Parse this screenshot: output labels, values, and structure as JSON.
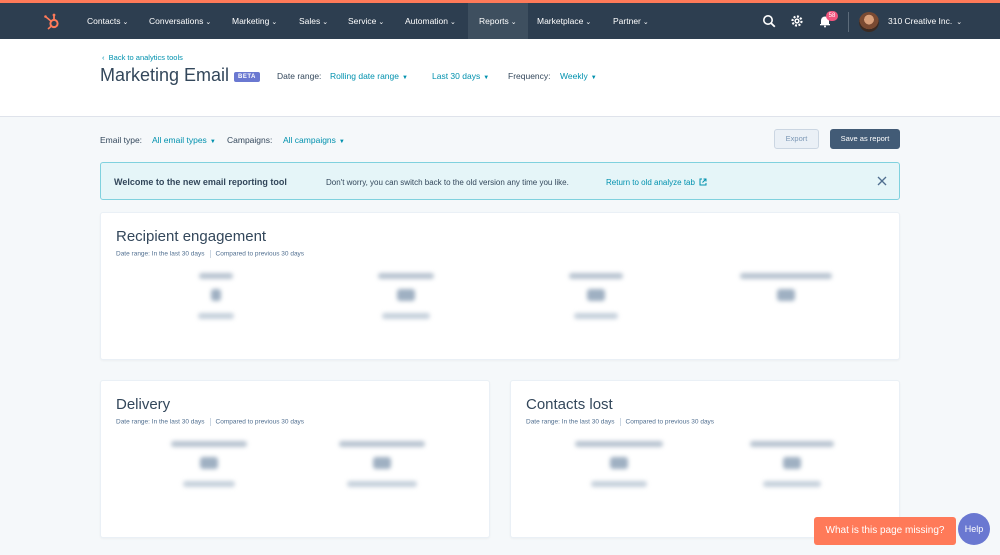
{
  "nav": {
    "items": [
      {
        "label": "Contacts"
      },
      {
        "label": "Conversations"
      },
      {
        "label": "Marketing"
      },
      {
        "label": "Sales"
      },
      {
        "label": "Service"
      },
      {
        "label": "Automation"
      },
      {
        "label": "Reports"
      },
      {
        "label": "Marketplace"
      },
      {
        "label": "Partner"
      }
    ],
    "active": "Reports",
    "notification_count": "58",
    "account": "310 Creative Inc."
  },
  "header": {
    "back_link": "Back to analytics tools",
    "title": "Marketing Email",
    "badge": "BETA",
    "date_range_label": "Date range:",
    "date_range_type": "Rolling date range",
    "date_range_value": "Last 30 days",
    "frequency_label": "Frequency:",
    "frequency_value": "Weekly"
  },
  "toolbar": {
    "email_type_label": "Email type:",
    "email_type_value": "All email types",
    "campaigns_label": "Campaigns:",
    "campaigns_value": "All campaigns",
    "export_label": "Export",
    "save_label": "Save as report"
  },
  "banner": {
    "title": "Welcome to the new email reporting tool",
    "text": "Don't worry, you can switch back to the old version any time you like.",
    "link": "Return to old analyze tab"
  },
  "cards": {
    "engagement": {
      "title": "Recipient engagement",
      "date_range": "Date range: In the last 30 days",
      "compared": "Compared to previous 30 days"
    },
    "delivery": {
      "title": "Delivery",
      "date_range": "Date range: In the last 30 days",
      "compared": "Compared to previous 30 days"
    },
    "contacts_lost": {
      "title": "Contacts lost",
      "date_range": "Date range: In the last 30 days",
      "compared": "Compared to previous 30 days"
    }
  },
  "floating": {
    "feedback": "What is this page missing?",
    "help": "Help"
  },
  "colors": {
    "nav_bg": "#2d3e50",
    "accent_orange": "#ff7a59",
    "link_teal": "#0091ae",
    "beta_purple": "#6a78d1"
  }
}
